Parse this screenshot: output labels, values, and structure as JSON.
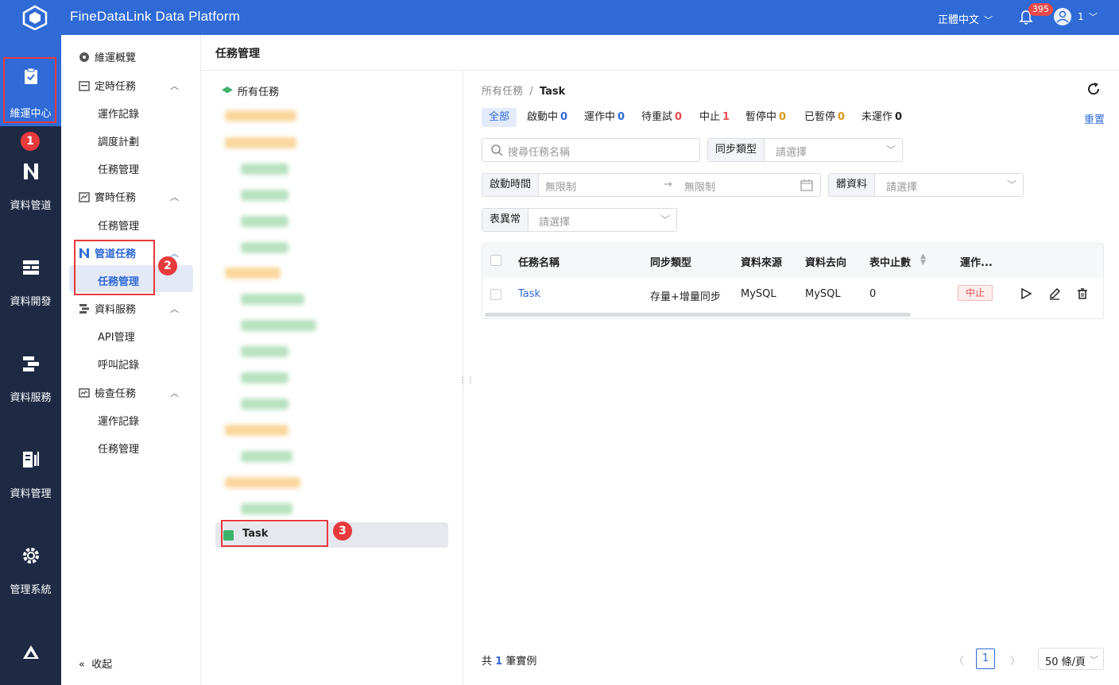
{
  "app": {
    "title": "FineDataLink Data Platform",
    "language": "正體中文",
    "notification_count": "395",
    "user_name": "1"
  },
  "leftnav": [
    {
      "label": "維運中心",
      "icon": "clipboard-check-icon"
    },
    {
      "label": "資料管道",
      "icon": "pipeline-icon"
    },
    {
      "label": "資料開發",
      "icon": "dev-icon"
    },
    {
      "label": "資料服務",
      "icon": "service-icon"
    },
    {
      "label": "資料管理",
      "icon": "data-manage-icon"
    },
    {
      "label": "管理系統",
      "icon": "gear-icon"
    },
    {
      "label": "",
      "icon": "resource-icon"
    }
  ],
  "submenu": {
    "overview": "維運概覽",
    "scheduled": {
      "label": "定時任務",
      "items": [
        "運作記錄",
        "調度計劃",
        "任務管理"
      ]
    },
    "realtime": {
      "label": "實時任務",
      "items": [
        "任務管理"
      ]
    },
    "pipeline": {
      "label": "管道任務",
      "items": [
        "任務管理"
      ]
    },
    "service": {
      "label": "資料服務",
      "items": [
        "API管理",
        "呼叫記錄"
      ]
    },
    "inspect": {
      "label": "檢查任務",
      "items": [
        "運作記錄",
        "任務管理"
      ]
    },
    "collapse": "收起"
  },
  "content_title": "任務管理",
  "tree": {
    "root": "所有任務",
    "selected": "Task"
  },
  "breadcrumb": {
    "root": "所有任務",
    "sep": "/",
    "current": "Task"
  },
  "status_tabs": [
    {
      "label": "全部",
      "count": ""
    },
    {
      "label": "啟動中",
      "count": "0"
    },
    {
      "label": "運作中",
      "count": "0"
    },
    {
      "label": "待重試",
      "count": "0"
    },
    {
      "label": "中止",
      "count": "1"
    },
    {
      "label": "暫停中",
      "count": "0"
    },
    {
      "label": "已暫停",
      "count": "0"
    },
    {
      "label": "未運作",
      "count": "0"
    }
  ],
  "status_colors": {
    "啟動中": "#2f6ad6",
    "運作中": "#2f6ad6",
    "待重試": "#e34d4d",
    "中止": "#e34d4d",
    "暫停中": "#d89a1c",
    "已暫停": "#d89a1c",
    "未運作": "#222222"
  },
  "reset": "重置",
  "filters": {
    "search_placeholder": "搜尋任務名稱",
    "sync_type": {
      "label": "同步類型",
      "placeholder": "請選擇"
    },
    "start_time": {
      "label": "啟動時間",
      "from": "無限制",
      "to": "無限制"
    },
    "dirty_data": {
      "label": "髒資料",
      "placeholder": "請選擇"
    },
    "table_anomaly": {
      "label": "表異常",
      "placeholder": "請選擇"
    }
  },
  "table": {
    "headers": [
      "任務名稱",
      "同步類型",
      "資料來源",
      "資料去向",
      "表中止數",
      "運作..."
    ],
    "rows": [
      {
        "name": "Task",
        "sync_type": "存量+增量同步",
        "source": "MySQL",
        "target": "MySQL",
        "stopped_tables": "0",
        "status": "中止"
      }
    ]
  },
  "footer": {
    "total_prefix": "共",
    "total": "1",
    "total_suffix": "筆實例",
    "page": "1",
    "page_size": "50 條/頁"
  },
  "annotations": [
    "1",
    "2",
    "3"
  ],
  "colors": {
    "brand": "#2f6ad6",
    "nav_bg": "#1e2a44",
    "annotation": "#e8393d"
  }
}
